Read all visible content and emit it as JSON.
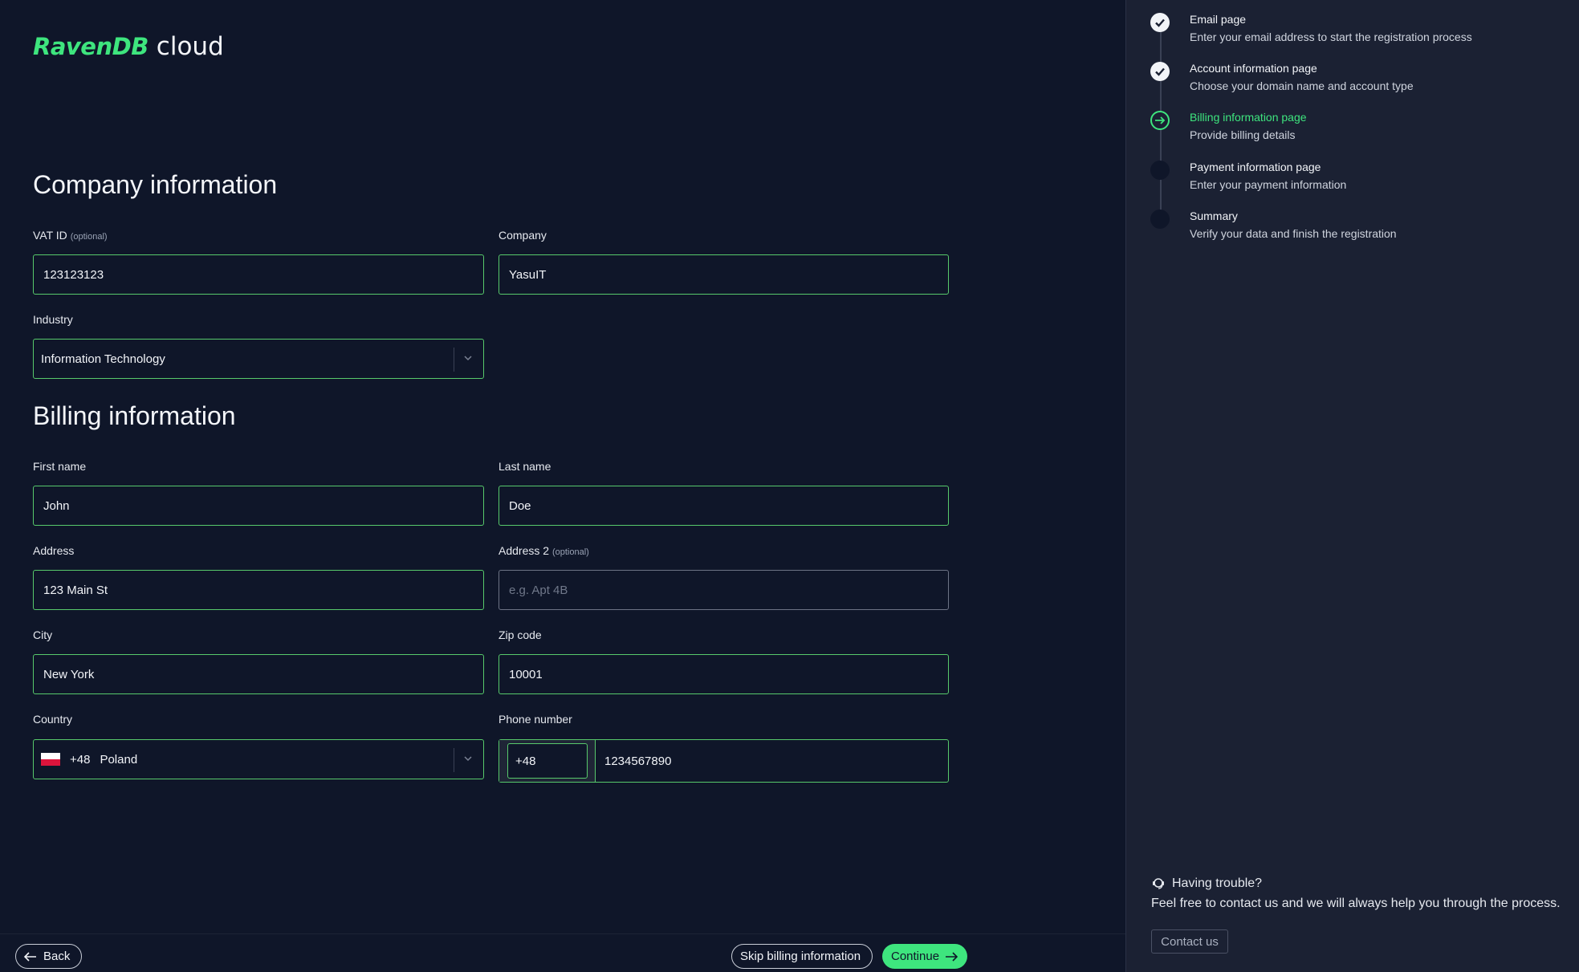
{
  "brand": {
    "name": "RavenDB",
    "product": "cloud"
  },
  "company_section": {
    "title": "Company information",
    "vat": {
      "label": "VAT ID",
      "optional": "(optional)",
      "value": "123123123"
    },
    "company": {
      "label": "Company",
      "value": "YasuIT"
    },
    "industry": {
      "label": "Industry",
      "value": "Information Technology"
    }
  },
  "billing_section": {
    "title": "Billing information",
    "first_name": {
      "label": "First name",
      "value": "John"
    },
    "last_name": {
      "label": "Last name",
      "value": "Doe"
    },
    "address": {
      "label": "Address",
      "value": "123 Main St"
    },
    "address2": {
      "label": "Address 2",
      "optional": "(optional)",
      "placeholder": "e.g. Apt 4B",
      "value": ""
    },
    "city": {
      "label": "City",
      "value": "New York"
    },
    "zip": {
      "label": "Zip code",
      "value": "10001"
    },
    "country": {
      "label": "Country",
      "code": "+48",
      "name": "Poland",
      "flag": "poland-flag-icon"
    },
    "phone": {
      "label": "Phone number",
      "code": "+48",
      "value": "1234567890"
    }
  },
  "footer": {
    "back_label": "Back",
    "skip_label": "Skip billing information",
    "continue_label": "Continue"
  },
  "steps": [
    {
      "title": "Email page",
      "desc": "Enter your email address to start the registration process",
      "status": "done"
    },
    {
      "title": "Account information page",
      "desc": "Choose your domain name and account type",
      "status": "done"
    },
    {
      "title": "Billing information page",
      "desc": "Provide billing details",
      "status": "current"
    },
    {
      "title": "Payment information page",
      "desc": "Enter your payment information",
      "status": "todo"
    },
    {
      "title": "Summary",
      "desc": "Verify your data and finish the registration",
      "status": "todo"
    }
  ],
  "help": {
    "title": "Having trouble?",
    "text": "Feel free to contact us and we will always help you through the process.",
    "contact_label": "Contact us"
  },
  "colors": {
    "accent": "#3ee57e",
    "background": "#0f1629",
    "sidebar": "#1b2133",
    "field_border": "#57c96b"
  }
}
